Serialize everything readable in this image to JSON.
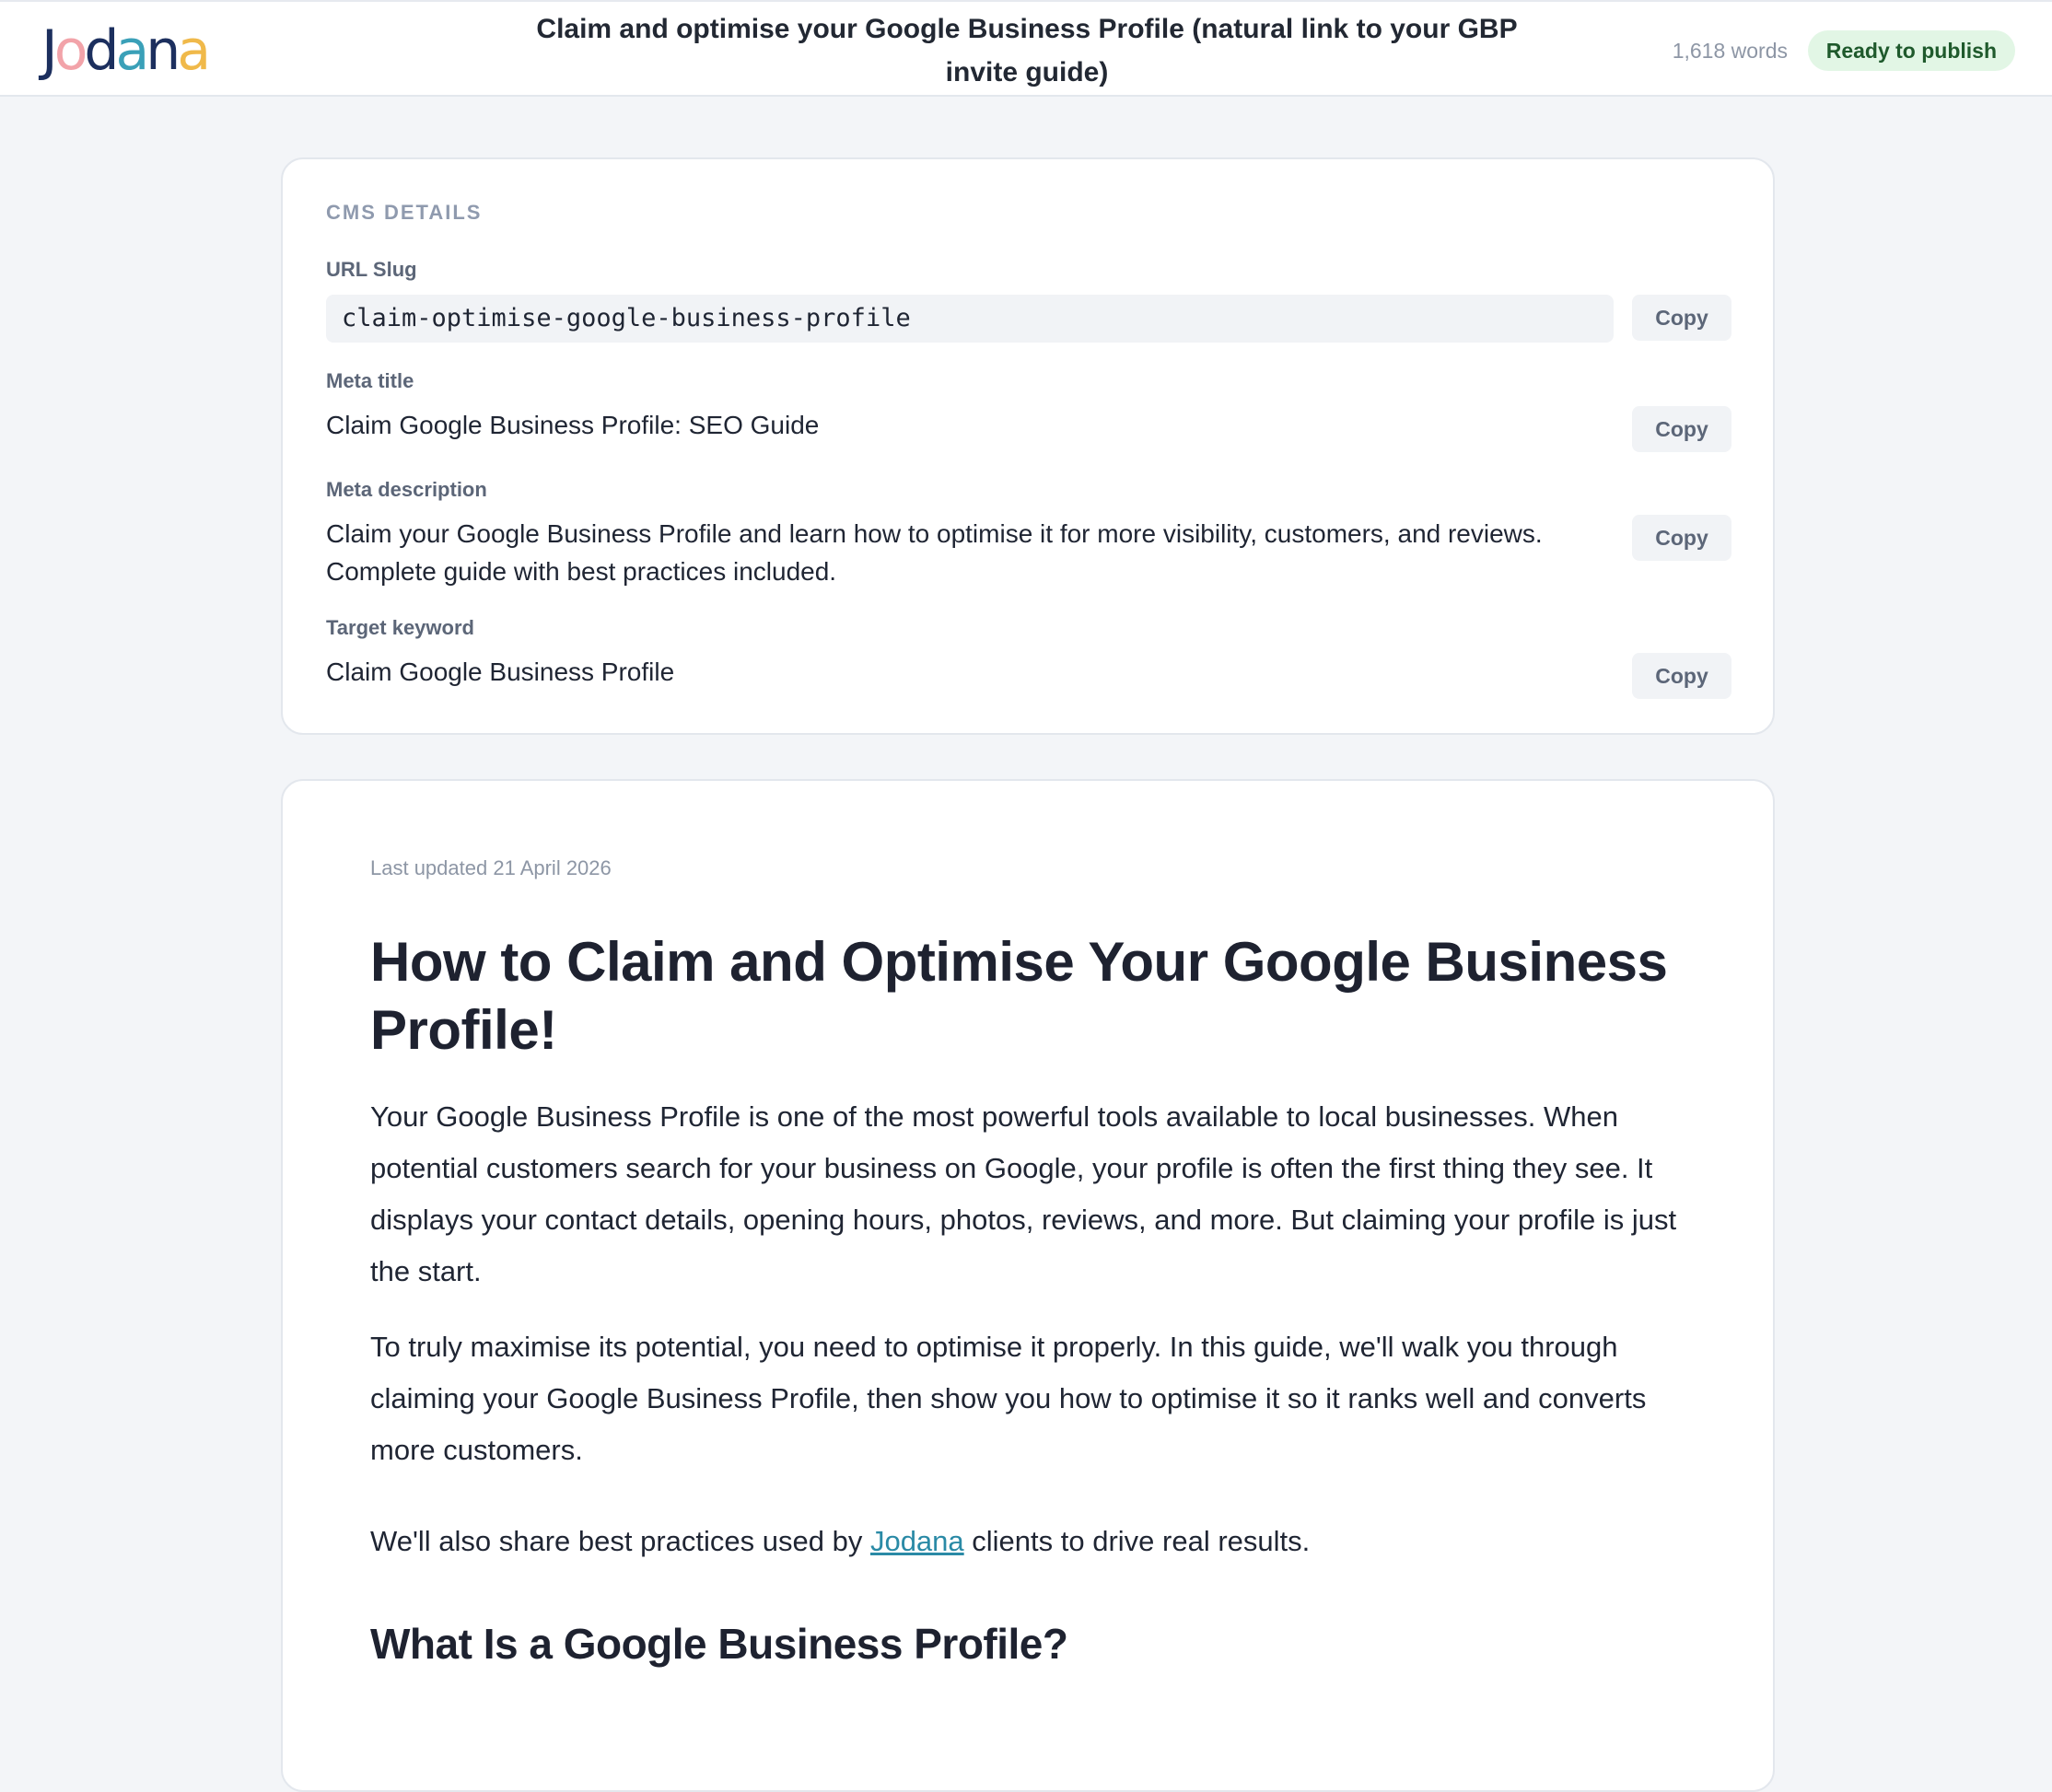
{
  "header": {
    "logo_letters": [
      "J",
      "o",
      "d",
      "a",
      "n",
      "a"
    ],
    "logo_colors": [
      "#1c2f5e",
      "#f2a3a9",
      "#1c2f5e",
      "#3aa0b8",
      "#1c2f5e",
      "#f0b94a"
    ],
    "doc_title": "Claim and optimise your Google Business Profile (natural link to your GBP invite guide)",
    "word_count": "1,618 words",
    "status": "Ready to publish"
  },
  "cms": {
    "heading": "CMS DETAILS",
    "copy_label": "Copy",
    "fields": {
      "slug_label": "URL Slug",
      "slug_value": "claim-optimise-google-business-profile",
      "meta_title_label": "Meta title",
      "meta_title_value": "Claim Google Business Profile: SEO Guide",
      "meta_description_label": "Meta description",
      "meta_description_value": "Claim your Google Business Profile and learn how to optimise it for more visibility, customers, and reviews. Complete guide with best practices included.",
      "target_keyword_label": "Target keyword",
      "target_keyword_value": "Claim Google Business Profile"
    }
  },
  "article": {
    "last_updated": "Last updated 21 April 2026",
    "h1": "How to Claim and Optimise Your Google Business Profile!",
    "p1": "Your Google Business Profile is one of the most powerful tools available to local businesses. When potential customers search for your business on Google, your profile is often the first thing they see. It displays your contact details, opening hours, photos, reviews, and more. But claiming your profile is just the start.",
    "p2": "To truly maximise its potential, you need to optimise it properly. In this guide, we'll walk you through claiming your Google Business Profile, then show you how to optimise it so it ranks well and converts more customers.",
    "p3_before": "We'll also share best practices used by ",
    "p3_link": "Jodana",
    "p3_after": " clients to drive real results.",
    "h2": "What Is a Google Business Profile?"
  }
}
